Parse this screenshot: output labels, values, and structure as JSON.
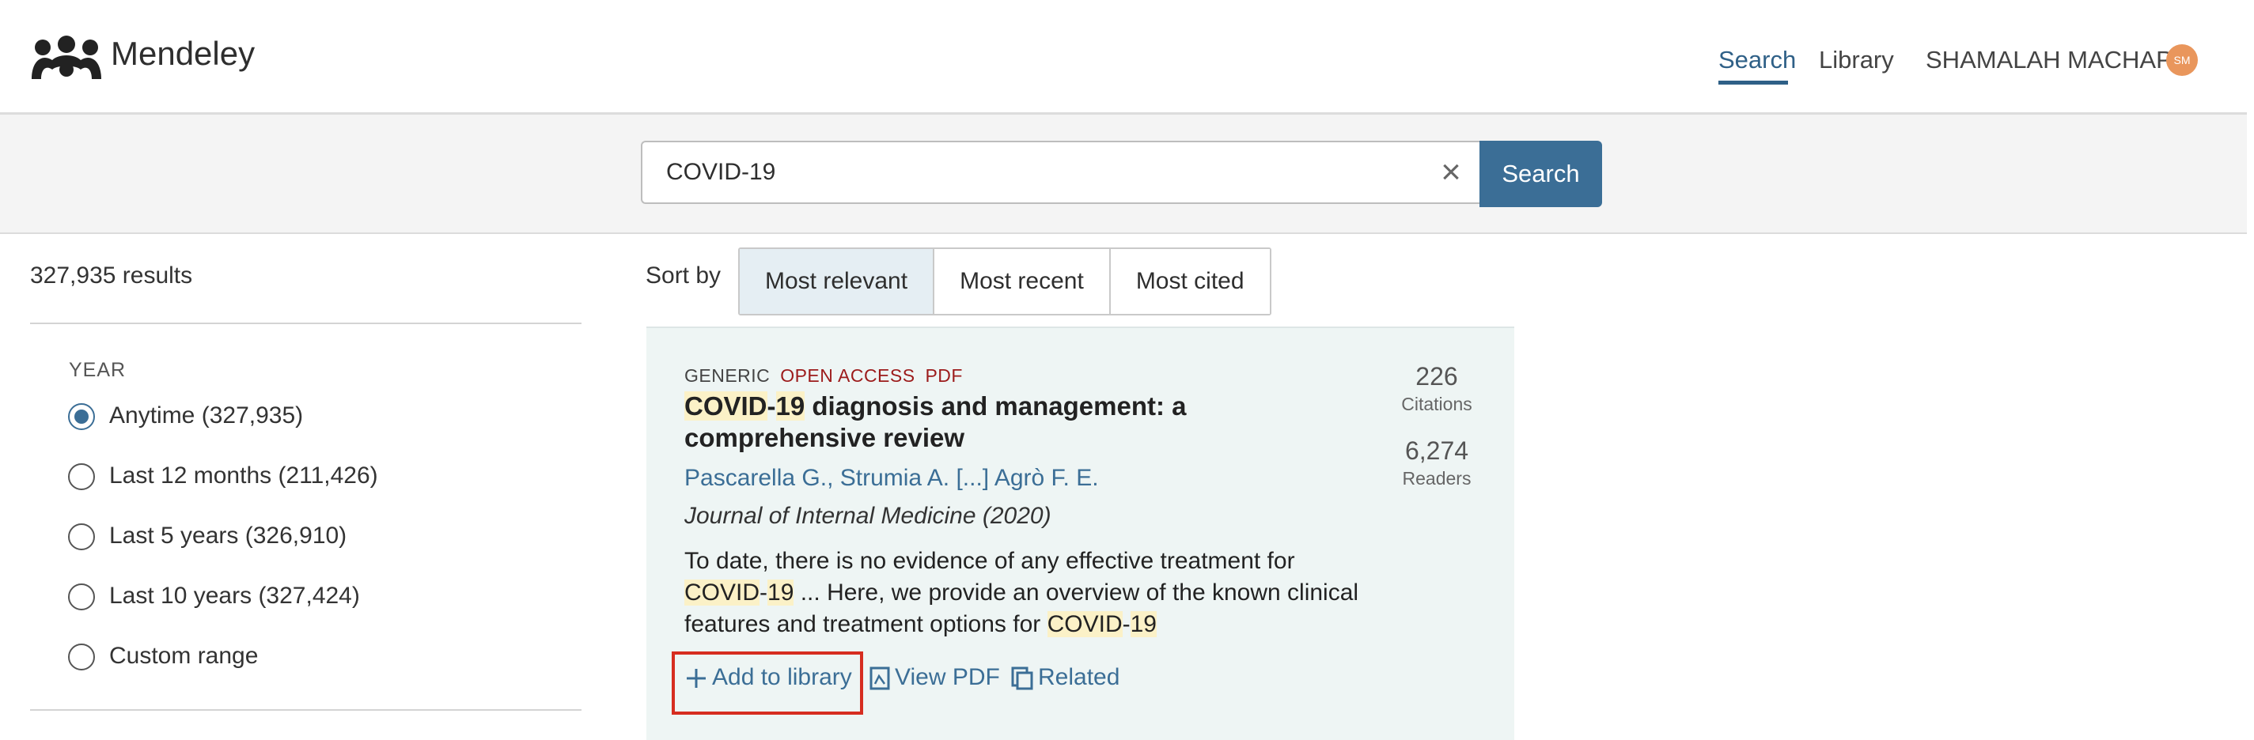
{
  "header": {
    "brand": "Mendeley",
    "nav": {
      "search": "Search",
      "library": "Library"
    },
    "user_name": "SHAMALAH MACHAP",
    "avatar_initials": "SM"
  },
  "search": {
    "query": "COVID-19",
    "button_label": "Search"
  },
  "sidebar": {
    "results_count": "327,935 results",
    "year_heading": "YEAR",
    "year_options": [
      {
        "label": "Anytime (327,935)",
        "checked": true
      },
      {
        "label": "Last 12 months (211,426)",
        "checked": false
      },
      {
        "label": "Last 5 years (326,910)",
        "checked": false
      },
      {
        "label": "Last 10 years (327,424)",
        "checked": false
      },
      {
        "label": "Custom range",
        "checked": false
      }
    ]
  },
  "sort": {
    "label": "Sort by",
    "options": [
      "Most relevant",
      "Most recent",
      "Most cited"
    ],
    "active": "Most relevant"
  },
  "result": {
    "tag_generic": "GENERIC",
    "tag_open_access": "OPEN ACCESS",
    "tag_pdf": "PDF",
    "title_hl1": "COVID",
    "title_dash": "-",
    "title_hl2": "19",
    "title_rest": " diagnosis and management: a comprehensive review",
    "authors": "Pascarella G., Strumia A. [...] Agrò F. E.",
    "journal": "Journal of Internal Medicine (2020)",
    "snippet_1": "To date, there is no evidence of any effective treatment for ",
    "snippet_hl1": "COVID",
    "snippet_dash1": "-",
    "snippet_hl2": "19",
    "snippet_2": " ... Here, we provide an overview of the known clinical features and treatment options for ",
    "snippet_hl3": "COVID",
    "snippet_dash2": "-",
    "snippet_hl4": "19",
    "citations_value": "226",
    "citations_label": "Citations",
    "readers_value": "6,274",
    "readers_label": "Readers",
    "actions": {
      "add": "Add to library",
      "view_pdf": "View PDF",
      "related": "Related"
    }
  },
  "colors": {
    "accent": "#3b6e96",
    "highlight": "#fbf1c7",
    "open_access": "#9c1b1b",
    "annotation_box": "#d62d20"
  }
}
